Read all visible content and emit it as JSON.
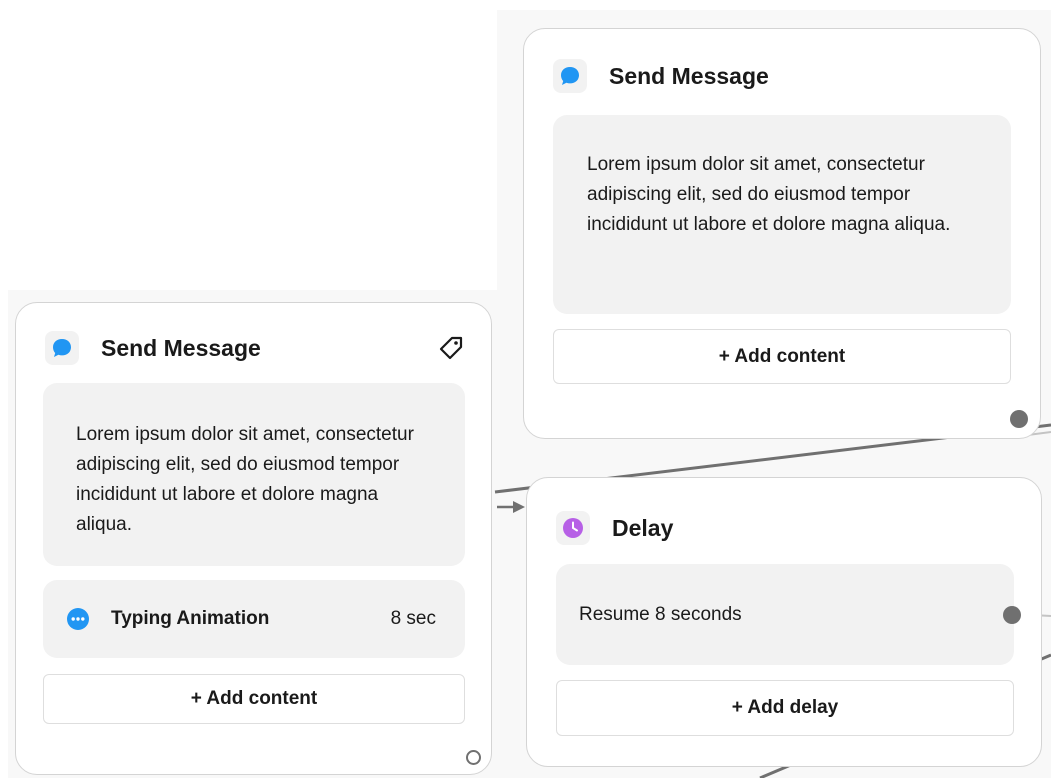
{
  "canvas": {
    "background": "#f8f8f8",
    "card_border": "#d4d4d4",
    "connector_color": "#707070"
  },
  "node_left": {
    "icon": "chat-bubble-icon",
    "icon_color": "#2196f3",
    "title": "Send Message",
    "tag_icon": "tag-icon",
    "message": "Lorem ipsum dolor sit amet, consectetur adipiscing elit, sed do eiusmod tempor incididunt ut labore et dolore magna aliqua.",
    "typing_icon": "typing-dots-icon",
    "typing_label": "Typing Animation",
    "typing_duration": "8 sec",
    "add_button": "+ Add content"
  },
  "node_top": {
    "icon": "chat-bubble-icon",
    "icon_color": "#2196f3",
    "title": "Send Message",
    "message": "Lorem ipsum dolor sit amet, consectetur adipiscing elit, sed do eiusmod tempor incididunt ut labore et dolore magna aliqua.",
    "add_button": "+ Add content"
  },
  "node_delay": {
    "icon": "clock-icon",
    "icon_color": "#b760e6",
    "title": "Delay",
    "resume_text": "Resume 8 seconds",
    "add_button": "+ Add delay"
  }
}
